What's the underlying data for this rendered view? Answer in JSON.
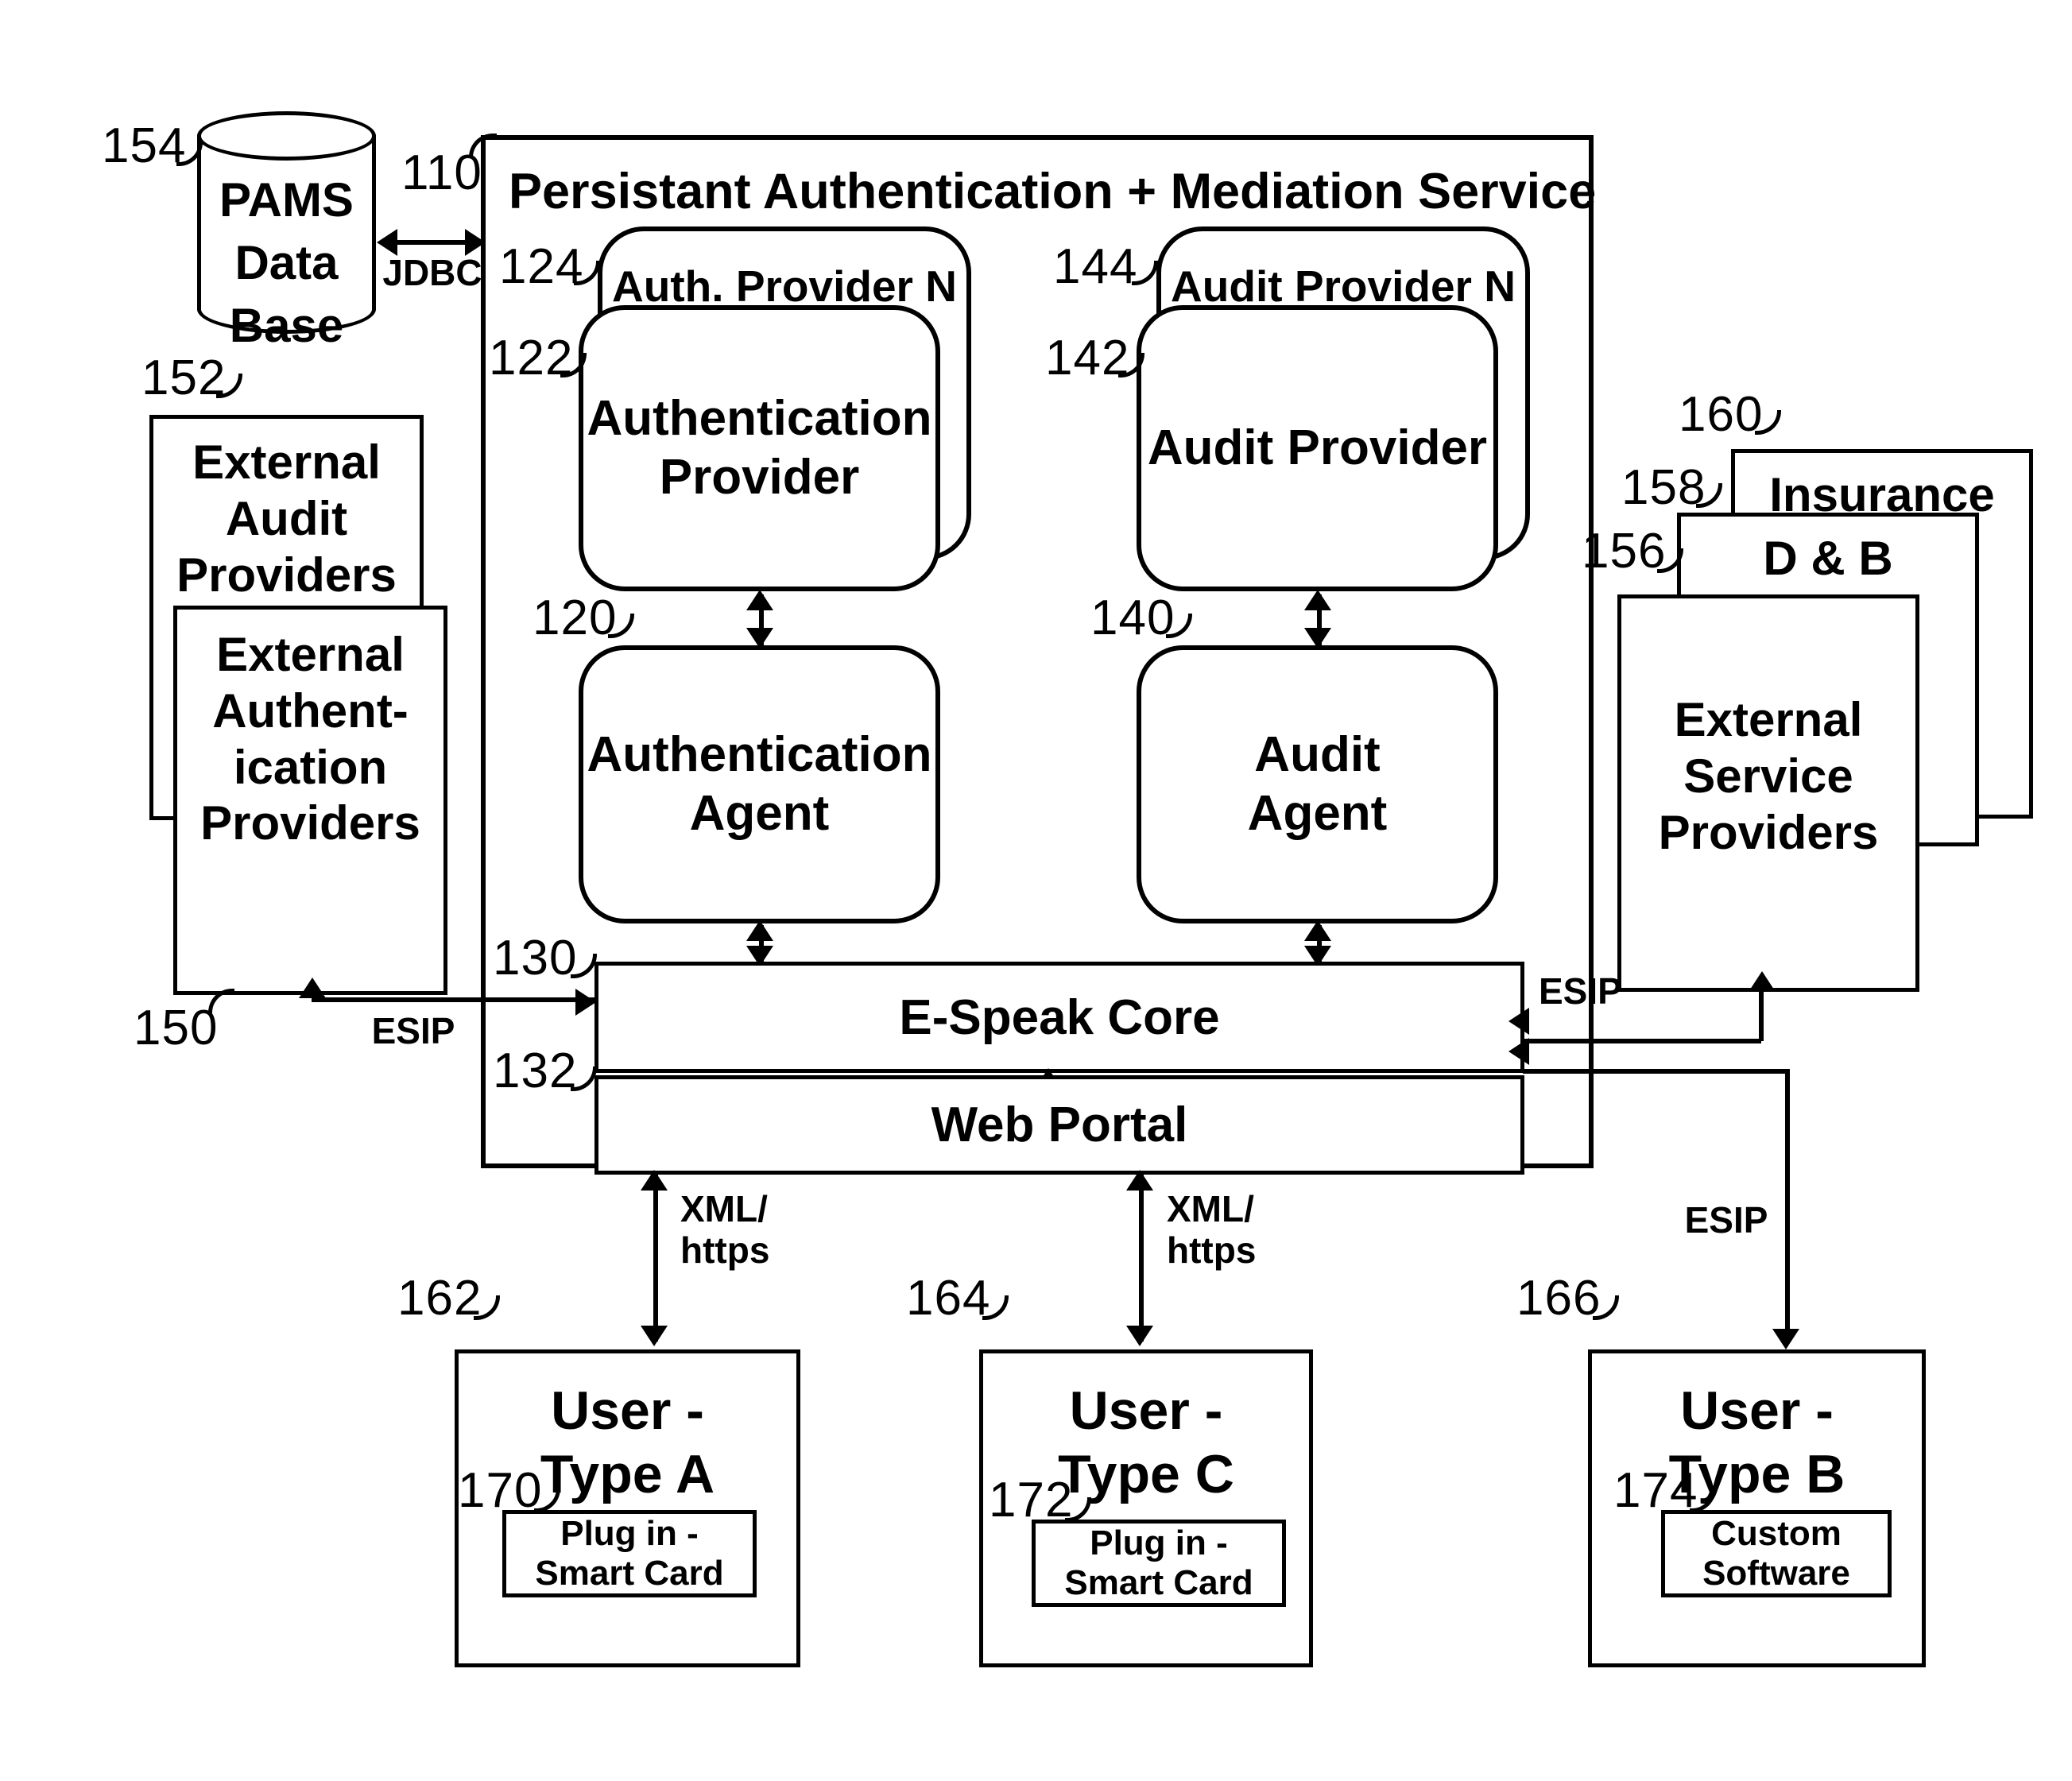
{
  "figure": {
    "type": "patent-block-diagram",
    "background": "#ffffff",
    "ink": "#000000"
  },
  "database": {
    "ref": "154",
    "label": "PAMS\nData\nBase"
  },
  "service": {
    "ref": "110",
    "title": "Persistant Authentication + Mediation Service",
    "auth_provider_n": {
      "ref": "124",
      "label": "Auth. Provider N"
    },
    "auth_provider": {
      "ref": "122",
      "label": "Authentication\nProvider"
    },
    "auth_agent": {
      "ref": "120",
      "label": "Authentication\nAgent"
    },
    "audit_provider_n": {
      "ref": "144",
      "label": "Audit Provider N"
    },
    "audit_provider": {
      "ref": "142",
      "label": "Audit Provider"
    },
    "audit_agent": {
      "ref": "140",
      "label": "Audit\nAgent"
    },
    "espeak_core": {
      "ref": "130",
      "label": "E-Speak Core"
    },
    "web_portal": {
      "ref": "132",
      "label": "Web Portal"
    }
  },
  "external_left": {
    "audit_providers": {
      "ref": "152",
      "label": "External\nAudit\nProviders"
    },
    "auth_providers": {
      "ref": "150",
      "label": "External\nAuthent-\nication\nProviders"
    }
  },
  "external_right": {
    "insurance": {
      "ref": "160",
      "label": "Insurance"
    },
    "dnb": {
      "ref": "158",
      "label": "D & B"
    },
    "service_providers": {
      "ref": "156",
      "label": "External\nService\nProviders"
    }
  },
  "users": [
    {
      "ref": "162",
      "label": "User -\nType A",
      "plugin": {
        "ref": "170",
        "label": "Plug in -\nSmart Card"
      }
    },
    {
      "ref": "164",
      "label": "User -\nType C",
      "plugin": {
        "ref": "172",
        "label": "Plug in -\nSmart Card"
      }
    },
    {
      "ref": "166",
      "label": "User -\nType  B",
      "plugin": {
        "ref": "174",
        "label": "Custom\nSoftware"
      }
    }
  ],
  "connections": {
    "jdbc": "JDBC",
    "esip_left": "ESIP",
    "esip_right": "ESIP",
    "esip_userb": "ESIP",
    "xml_https_a": "XML/\nhttps",
    "xml_https_c": "XML/\nhttps"
  }
}
